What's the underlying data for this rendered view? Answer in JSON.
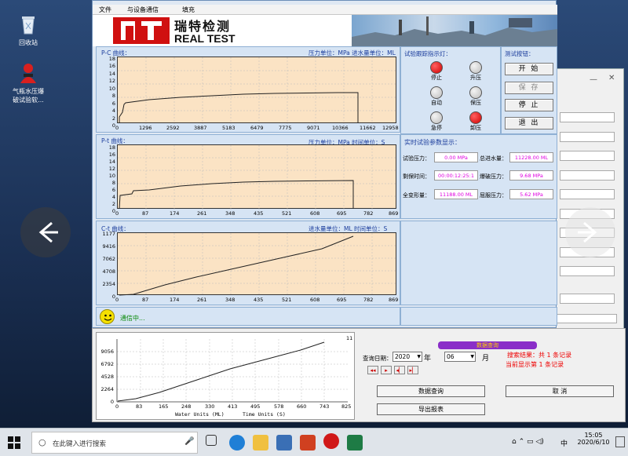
{
  "desktop": {
    "icons": [
      {
        "label": "回收站"
      },
      {
        "label": "气瓶水压爆\n破试验软..."
      }
    ]
  },
  "menu": [
    "文件",
    "与设备通信",
    "填充"
  ],
  "banner": {
    "company_cn": "瑞特检测",
    "company_en": "REAL TEST"
  },
  "pc_chart": {
    "title": "P-C 曲线：",
    "units": "压力单位：MPa  进水量单位：ML",
    "y_ticks": [
      "0",
      "2",
      "4",
      "6",
      "8",
      "10",
      "12",
      "14",
      "16",
      "18"
    ],
    "x_ticks": [
      "0",
      "1296",
      "2592",
      "3887",
      "5183",
      "6479",
      "7775",
      "9071",
      "10366",
      "11662",
      "12958"
    ]
  },
  "pt_chart": {
    "title": "P-t 曲线：",
    "units": "压力单位：MPa  时间单位：S",
    "y_ticks": [
      "0",
      "2",
      "4",
      "6",
      "8",
      "10",
      "12",
      "14",
      "16",
      "18"
    ],
    "x_ticks": [
      "0",
      "87",
      "174",
      "261",
      "348",
      "435",
      "521",
      "608",
      "695",
      "782",
      "869"
    ]
  },
  "ct_chart": {
    "title": "C-t 曲线：",
    "units": "进水量单位：ML  时间单位：S",
    "y_ticks": [
      "0",
      "2354",
      "4708",
      "7062",
      "9416",
      "1177"
    ],
    "x_ticks": [
      "0",
      "87",
      "174",
      "261",
      "348",
      "435",
      "521",
      "608",
      "695",
      "782",
      "869"
    ]
  },
  "lamps": {
    "title": "试验跟踪指示灯：",
    "items": [
      {
        "label": "停止",
        "state": "on"
      },
      {
        "label": "升压",
        "state": "off"
      },
      {
        "label": "自动",
        "state": "off"
      },
      {
        "label": "保压",
        "state": "off"
      },
      {
        "label": "急停",
        "state": "off"
      },
      {
        "label": "卸压",
        "state": "on"
      }
    ]
  },
  "test_buttons": {
    "title": "测试按钮：",
    "start": "开 始",
    "save": "保 存",
    "stop": "停 止",
    "exit": "退 出"
  },
  "params": {
    "title": "实时试验参数显示：",
    "items": [
      {
        "label": "试验压力：",
        "value": "0.00 MPa"
      },
      {
        "label": "总进水量：",
        "value": "11228.00 ML"
      },
      {
        "label": "剩保时间：",
        "value": "00:00:12:25:1"
      },
      {
        "label": "爆破压力：",
        "value": "9.68 MPa"
      },
      {
        "label": "全变形量：",
        "value": "11188.00 ML"
      },
      {
        "label": "屈服压力：",
        "value": "5.62 MPa"
      }
    ]
  },
  "status": {
    "text": "通信中..."
  },
  "lower_chart": {
    "y_ticks": [
      "0",
      "2264",
      "4528",
      "6792",
      "9056",
      "11"
    ],
    "x_ticks": [
      "0",
      "83",
      "165",
      "248",
      "330",
      "413",
      "495",
      "578",
      "660",
      "743",
      "825"
    ],
    "xlabel_left": "Water Units (ML)",
    "xlabel_right": "Time Units (S)"
  },
  "query": {
    "header": "数据查询",
    "date_label": "查询日期：",
    "year_value": "2020",
    "year_unit": "年",
    "month_value": "06",
    "month_unit": "月",
    "result_line1": "搜索结果：共 1 条记录",
    "result_line2": "当前显示第 1 条记录",
    "query_button": "数据查询",
    "export_button": "导出报表",
    "cancel_button": "取    消"
  },
  "taskbar": {
    "search_placeholder": "在此键入进行搜索",
    "time": "15:05",
    "date": "2020/6/10",
    "ime": "中"
  }
}
